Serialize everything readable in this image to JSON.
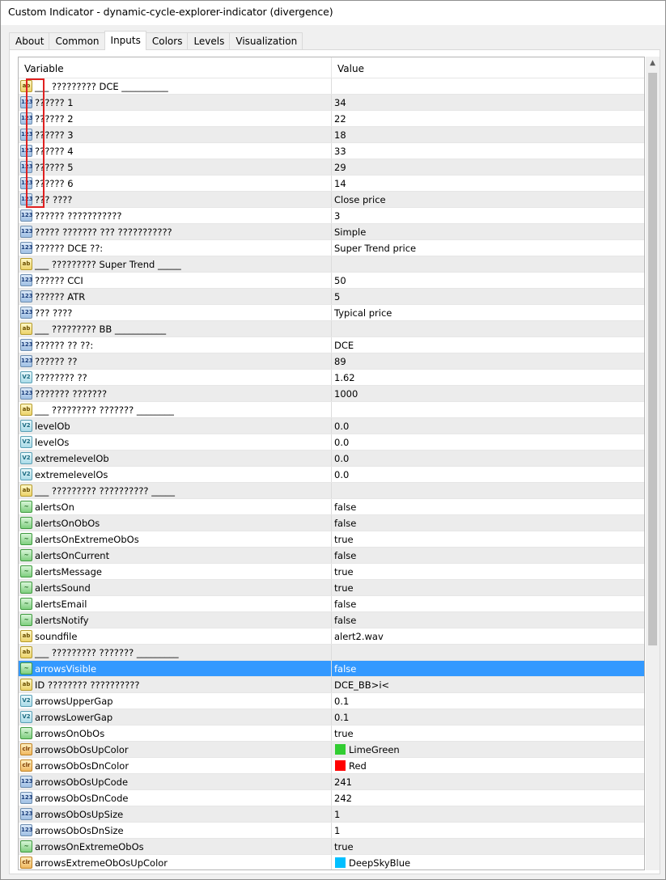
{
  "window": {
    "title": "Custom Indicator - dynamic-cycle-explorer-indicator (divergence)"
  },
  "tabs": [
    "About",
    "Common",
    "Inputs",
    "Colors",
    "Levels",
    "Visualization"
  ],
  "active_tab": "Inputs",
  "table": {
    "headers": {
      "variable": "Variable",
      "value": "Value"
    },
    "rows": [
      {
        "type": "str",
        "name": "___ ????????? DCE __________",
        "value": ""
      },
      {
        "type": "int",
        "name": "?????? 1",
        "value": "34"
      },
      {
        "type": "int",
        "name": "?????? 2",
        "value": "22"
      },
      {
        "type": "int",
        "name": "?????? 3",
        "value": "18"
      },
      {
        "type": "int",
        "name": "?????? 4",
        "value": "33"
      },
      {
        "type": "int",
        "name": "?????? 5",
        "value": "29"
      },
      {
        "type": "int",
        "name": "?????? 6",
        "value": "14"
      },
      {
        "type": "int",
        "name": "??? ????",
        "value": "Close price"
      },
      {
        "type": "int",
        "name": "?????? ???????????",
        "value": "3"
      },
      {
        "type": "int",
        "name": "????? ??????? ??? ???????????",
        "value": "Simple"
      },
      {
        "type": "int",
        "name": "?????? DCE ??:",
        "value": "Super Trend price"
      },
      {
        "type": "str",
        "name": "___ ????????? Super Trend _____",
        "value": ""
      },
      {
        "type": "int",
        "name": "?????? CCI",
        "value": "50"
      },
      {
        "type": "int",
        "name": "?????? ATR",
        "value": "5"
      },
      {
        "type": "int",
        "name": "??? ????",
        "value": "Typical price"
      },
      {
        "type": "str",
        "name": "___ ????????? BB ___________",
        "value": ""
      },
      {
        "type": "int",
        "name": "?????? ?? ??:",
        "value": "DCE"
      },
      {
        "type": "int",
        "name": "?????? ??",
        "value": "89"
      },
      {
        "type": "dbl",
        "name": "???????? ??",
        "value": "1.62"
      },
      {
        "type": "int",
        "name": "??????? ???????",
        "value": "1000"
      },
      {
        "type": "str",
        "name": "___ ????????? ??????? ________",
        "value": ""
      },
      {
        "type": "dbl",
        "name": "levelOb",
        "value": "0.0"
      },
      {
        "type": "dbl",
        "name": "levelOs",
        "value": "0.0"
      },
      {
        "type": "dbl",
        "name": "extremelevelOb",
        "value": "0.0"
      },
      {
        "type": "dbl",
        "name": "extremelevelOs",
        "value": "0.0"
      },
      {
        "type": "str",
        "name": "___ ????????? ?????????? _____",
        "value": ""
      },
      {
        "type": "bool",
        "name": "alertsOn",
        "value": "false"
      },
      {
        "type": "bool",
        "name": "alertsOnObOs",
        "value": "false"
      },
      {
        "type": "bool",
        "name": "alertsOnExtremeObOs",
        "value": "true"
      },
      {
        "type": "bool",
        "name": "alertsOnCurrent",
        "value": "false"
      },
      {
        "type": "bool",
        "name": "alertsMessage",
        "value": "true"
      },
      {
        "type": "bool",
        "name": "alertsSound",
        "value": "true"
      },
      {
        "type": "bool",
        "name": "alertsEmail",
        "value": "false"
      },
      {
        "type": "bool",
        "name": "alertsNotify",
        "value": "false"
      },
      {
        "type": "str",
        "name": "soundfile",
        "value": "alert2.wav"
      },
      {
        "type": "str",
        "name": "___ ????????? ??????? _________",
        "value": ""
      },
      {
        "type": "bool",
        "name": "arrowsVisible",
        "value": "false",
        "selected": true
      },
      {
        "type": "str",
        "name": "ID ???????? ??????????",
        "value": "DCE_BB>i<"
      },
      {
        "type": "dbl",
        "name": "arrowsUpperGap",
        "value": "0.1"
      },
      {
        "type": "dbl",
        "name": "arrowsLowerGap",
        "value": "0.1"
      },
      {
        "type": "bool",
        "name": "arrowsOnObOs",
        "value": "true"
      },
      {
        "type": "color",
        "name": "arrowsObOsUpColor",
        "value": "LimeGreen",
        "swatch": "#32cd32"
      },
      {
        "type": "color",
        "name": "arrowsObOsDnColor",
        "value": "Red",
        "swatch": "#ff0000"
      },
      {
        "type": "int",
        "name": "arrowsObOsUpCode",
        "value": "241"
      },
      {
        "type": "int",
        "name": "arrowsObOsDnCode",
        "value": "242"
      },
      {
        "type": "int",
        "name": "arrowsObOsUpSize",
        "value": "1"
      },
      {
        "type": "int",
        "name": "arrowsObOsDnSize",
        "value": "1"
      },
      {
        "type": "bool",
        "name": "arrowsOnExtremeObOs",
        "value": "true"
      },
      {
        "type": "color",
        "name": "arrowsExtremeObOsUpColor",
        "value": "DeepSkyBlue",
        "swatch": "#00bfff"
      }
    ]
  },
  "icons": {
    "str": "ab",
    "int": "123",
    "dbl": "V2",
    "bool": "~",
    "color": "clr"
  },
  "colors": {
    "selection": "#3399ff",
    "highlight_box": "#e02020"
  }
}
